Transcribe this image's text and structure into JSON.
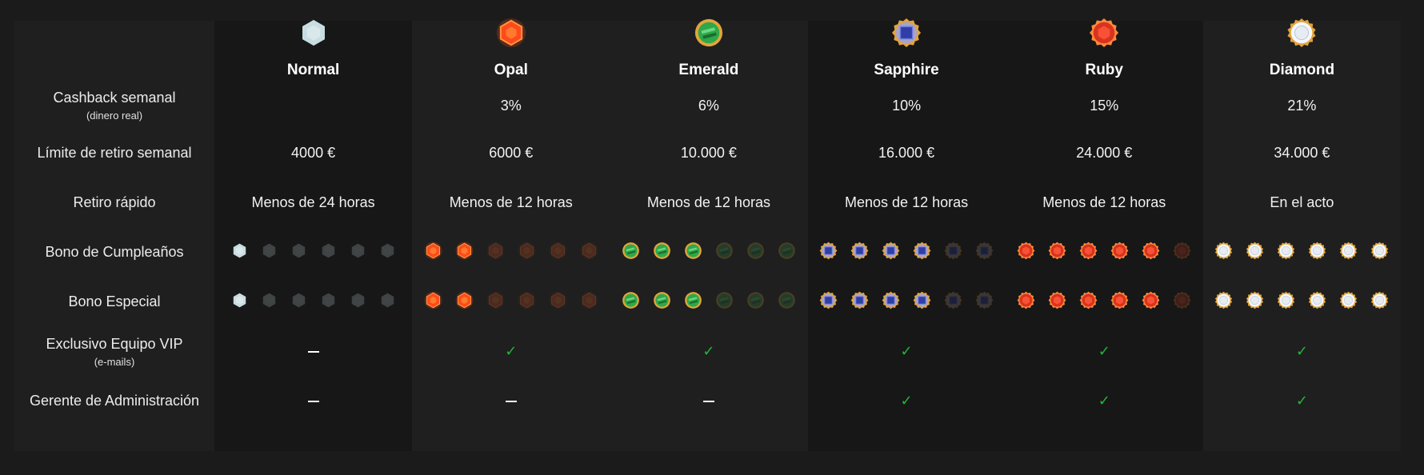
{
  "row_labels": {
    "cashback": {
      "main": "Cashback semanal",
      "sub": "(dinero real)"
    },
    "withdraw_limit": {
      "main": "Límite de retiro semanal"
    },
    "fast_withdraw": {
      "main": "Retiro rápido"
    },
    "birthday_bonus": {
      "main": "Bono de Cumpleaños"
    },
    "special_bonus": {
      "main": "Bono Especial"
    },
    "vip_team": {
      "main": "Exclusivo Equipo VIP",
      "sub": "(e-mails)"
    },
    "manager": {
      "main": "Gerente de Administración"
    }
  },
  "tiers": [
    {
      "name": "Normal",
      "gem_icon": "hexagon-gem-icon",
      "color": "#c8dde2",
      "cashback": "",
      "withdraw_limit": "4000 €",
      "fast_withdraw": "Menos de 24 horas",
      "birthday_bonus_level": 1,
      "special_bonus_level": 1,
      "vip_team": "dash",
      "manager": "dash"
    },
    {
      "name": "Opal",
      "gem_icon": "opal-gem-icon",
      "color": "#ff4a1c",
      "cashback": "3%",
      "withdraw_limit": "6000 €",
      "fast_withdraw": "Menos de 12 horas",
      "birthday_bonus_level": 2,
      "special_bonus_level": 2,
      "vip_team": "check",
      "manager": "dash"
    },
    {
      "name": "Emerald",
      "gem_icon": "emerald-gem-icon",
      "color": "#2ea84a",
      "cashback": "6%",
      "withdraw_limit": "10.000 €",
      "fast_withdraw": "Menos de 12 horas",
      "birthday_bonus_level": 3,
      "special_bonus_level": 3,
      "vip_team": "check",
      "manager": "dash"
    },
    {
      "name": "Sapphire",
      "gem_icon": "sapphire-gem-icon",
      "color": "#2f3fa8",
      "cashback": "10%",
      "withdraw_limit": "16.000 €",
      "fast_withdraw": "Menos de 12 horas",
      "birthday_bonus_level": 4,
      "special_bonus_level": 4,
      "vip_team": "check",
      "manager": "check"
    },
    {
      "name": "Ruby",
      "gem_icon": "ruby-gem-icon",
      "color": "#d9321f",
      "cashback": "15%",
      "withdraw_limit": "24.000 €",
      "fast_withdraw": "Menos de 12 horas",
      "birthday_bonus_level": 5,
      "special_bonus_level": 5,
      "vip_team": "check",
      "manager": "check"
    },
    {
      "name": "Diamond",
      "gem_icon": "diamond-gem-icon",
      "color": "#e6ecf2",
      "cashback": "21%",
      "withdraw_limit": "34.000 €",
      "fast_withdraw": "En el acto",
      "birthday_bonus_level": 6,
      "special_bonus_level": 6,
      "vip_team": "check",
      "manager": "check"
    }
  ],
  "bonus_max": 6,
  "colors": {
    "page_bg": "#1b1b1b",
    "panel_bg": "#1f1f1f",
    "dark_col_bg": "#171717",
    "check": "#1fb836",
    "ring": "#e3a43a"
  },
  "symbols": {
    "check": "✓"
  }
}
